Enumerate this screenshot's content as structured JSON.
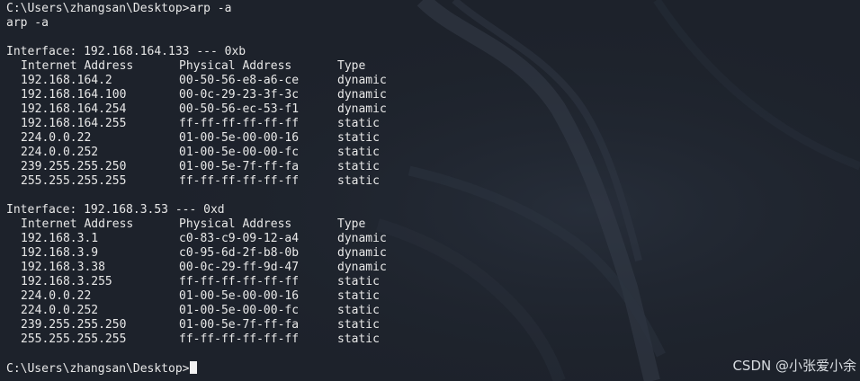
{
  "terminal": {
    "command_line": "C:\\Users\\zhangsan\\Desktop>arp -a",
    "echo_line": "arp -a",
    "final_prompt": "C:\\Users\\zhangsan\\Desktop>"
  },
  "headers": [
    "Internet Address",
    "Physical Address",
    "Type"
  ],
  "interfaces": [
    {
      "title": "Interface: 192.168.164.133 --- 0xb",
      "rows": [
        [
          "192.168.164.2",
          "00-50-56-e8-a6-ce",
          "dynamic"
        ],
        [
          "192.168.164.100",
          "00-0c-29-23-3f-3c",
          "dynamic"
        ],
        [
          "192.168.164.254",
          "00-50-56-ec-53-f1",
          "dynamic"
        ],
        [
          "192.168.164.255",
          "ff-ff-ff-ff-ff-ff",
          "static"
        ],
        [
          "224.0.0.22",
          "01-00-5e-00-00-16",
          "static"
        ],
        [
          "224.0.0.252",
          "01-00-5e-00-00-fc",
          "static"
        ],
        [
          "239.255.255.250",
          "01-00-5e-7f-ff-fa",
          "static"
        ],
        [
          "255.255.255.255",
          "ff-ff-ff-ff-ff-ff",
          "static"
        ]
      ]
    },
    {
      "title": "Interface: 192.168.3.53 --- 0xd",
      "rows": [
        [
          "192.168.3.1",
          "c0-83-c9-09-12-a4",
          "dynamic"
        ],
        [
          "192.168.3.9",
          "c0-95-6d-2f-b8-0b",
          "dynamic"
        ],
        [
          "192.168.3.38",
          "00-0c-29-ff-9d-47",
          "dynamic"
        ],
        [
          "192.168.3.255",
          "ff-ff-ff-ff-ff-ff",
          "static"
        ],
        [
          "224.0.0.22",
          "01-00-5e-00-00-16",
          "static"
        ],
        [
          "224.0.0.252",
          "01-00-5e-00-00-fc",
          "static"
        ],
        [
          "239.255.255.250",
          "01-00-5e-7f-ff-fa",
          "static"
        ],
        [
          "255.255.255.255",
          "ff-ff-ff-ff-ff-ff",
          "static"
        ]
      ]
    }
  ],
  "watermark": "CSDN @小张爱小余",
  "colors": {
    "background": "#1d222b",
    "text": "#e8e8e8",
    "cursor": "#f2f2f2"
  }
}
